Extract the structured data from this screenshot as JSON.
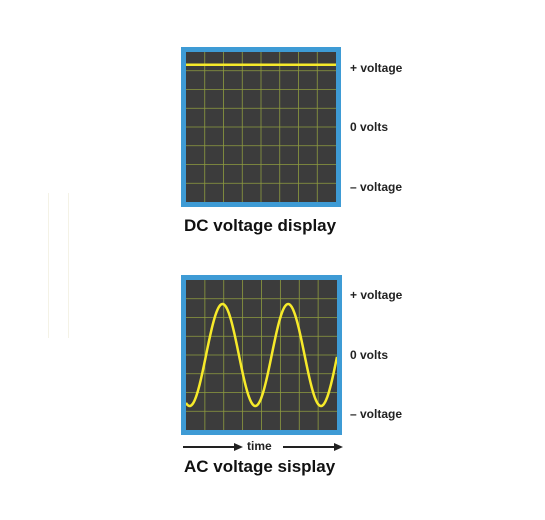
{
  "dc_panel": {
    "labels": {
      "top": "+ voltage",
      "middle": "0 volts",
      "bottom": "– voltage"
    },
    "caption": "DC voltage display",
    "trace_level": 0.83
  },
  "ac_panel": {
    "labels": {
      "top": "+ voltage",
      "middle": "0 volts",
      "bottom": "– voltage"
    },
    "caption": "AC voltage sisplay",
    "time_label": "time",
    "wave": {
      "cycles": 2.3,
      "amplitude": 0.68
    }
  },
  "colors": {
    "frame": "#3e9bd5",
    "screen": "#3c3c3c",
    "grid": "#8e9b3f",
    "trace": "#f7ea2a"
  }
}
